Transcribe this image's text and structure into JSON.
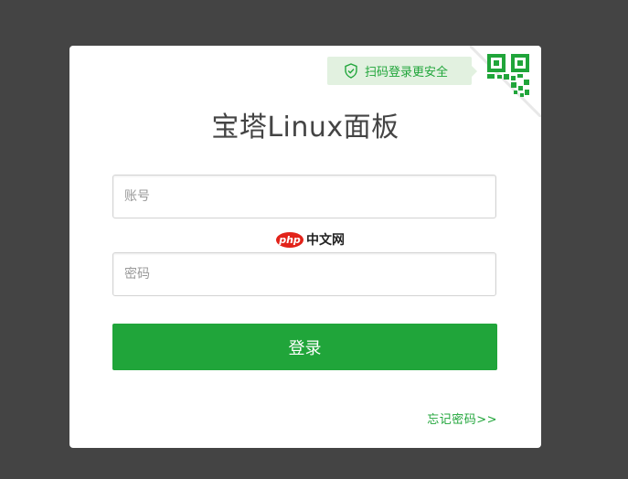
{
  "login": {
    "title": "宝塔Linux面板",
    "scan_tip": "扫码登录更安全",
    "username": {
      "value": "",
      "placeholder": "账号"
    },
    "password": {
      "value": "",
      "placeholder": "密码"
    },
    "submit_label": "登录",
    "forgot_label": "忘记密码>>"
  },
  "watermark": {
    "logo_text": "php",
    "site_text": "中文网"
  },
  "colors": {
    "background": "#444444",
    "card": "#ffffff",
    "accent": "#20a53a",
    "tip_bg": "#e2f1e0",
    "text": "#444444"
  },
  "icons": {
    "tip": "shield-check-icon",
    "corner": "qr-code-icon"
  }
}
